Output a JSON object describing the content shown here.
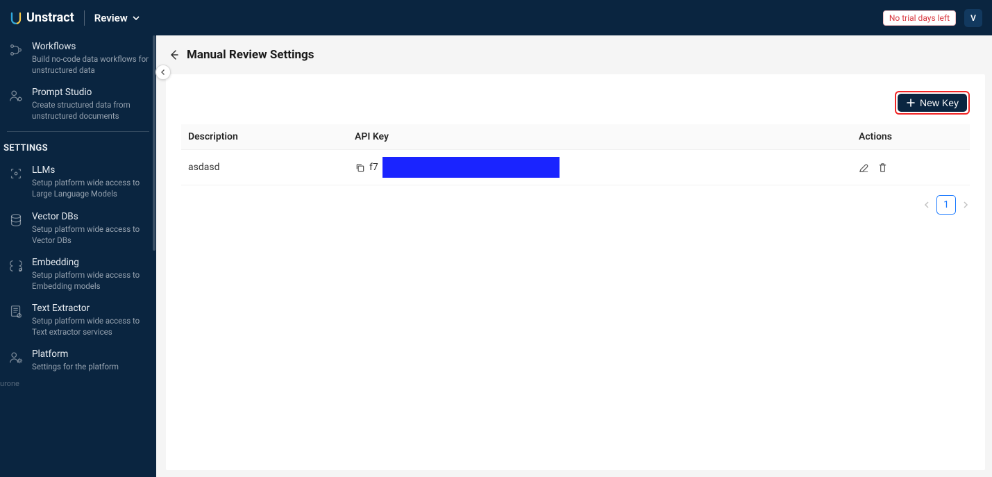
{
  "header": {
    "brand": "Unstract",
    "dropdown_label": "Review",
    "trial_text": "No trial days left",
    "avatar_letter": "V"
  },
  "sidebar": {
    "items_top": [
      {
        "title": "Workflows",
        "desc": "Build no-code data workflows for unstructured data"
      },
      {
        "title": "Prompt Studio",
        "desc": "Create structured data from unstructured documents"
      }
    ],
    "section_title": "SETTINGS",
    "items_settings": [
      {
        "title": "LLMs",
        "desc": "Setup platform wide access to Large Language Models"
      },
      {
        "title": "Vector DBs",
        "desc": "Setup platform wide access to Vector DBs"
      },
      {
        "title": "Embedding",
        "desc": "Setup platform wide access to Embedding models"
      },
      {
        "title": "Text Extractor",
        "desc": "Setup platform wide access to Text extractor services"
      },
      {
        "title": "Platform",
        "desc": "Settings for the platform"
      }
    ],
    "bottom_partial": "urone"
  },
  "page": {
    "title": "Manual Review Settings",
    "new_key_label": "New Key"
  },
  "table": {
    "columns": {
      "description": "Description",
      "apikey": "API Key",
      "actions": "Actions"
    },
    "rows": [
      {
        "description": "asdasd",
        "apikey_prefix": "f7"
      }
    ]
  },
  "pagination": {
    "current_page": "1"
  }
}
